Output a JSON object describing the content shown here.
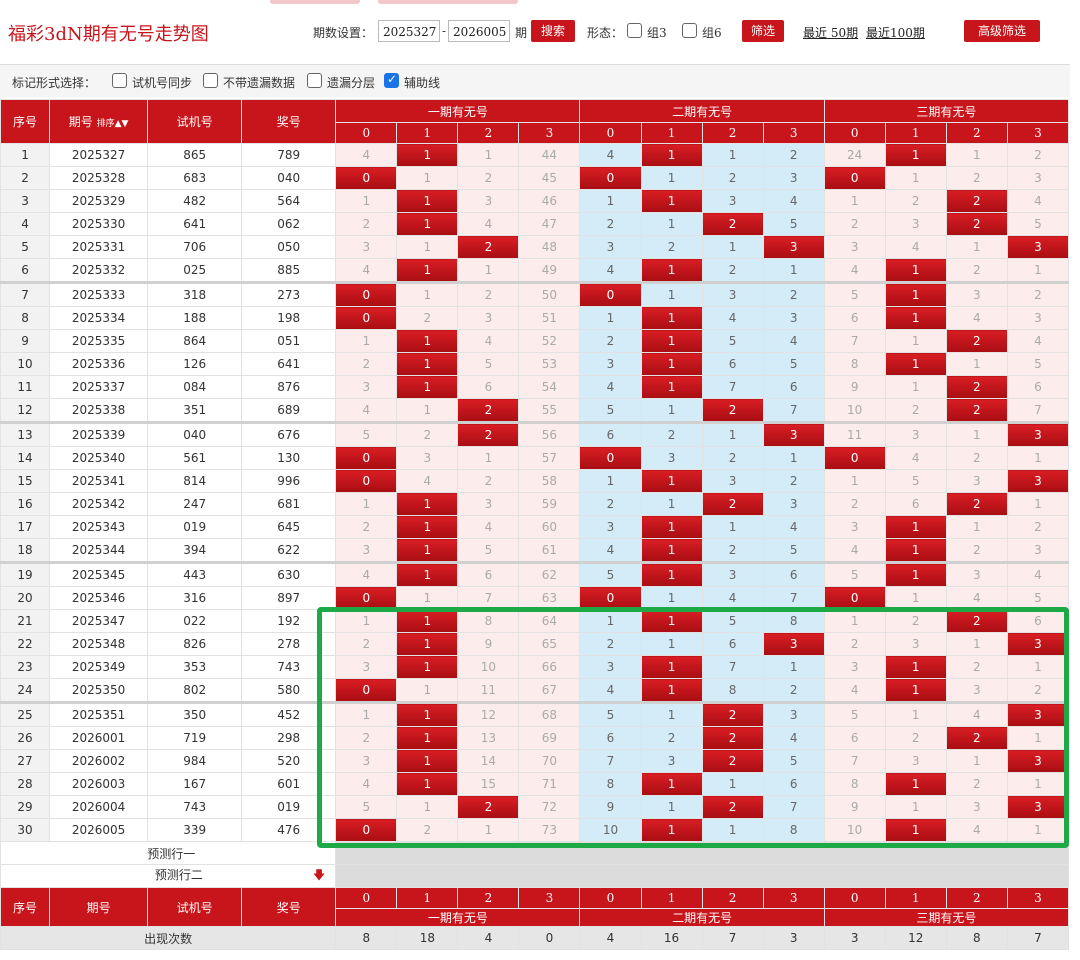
{
  "header": {
    "title": "福彩3dN期有无号走势图",
    "period_label": "期数设置：",
    "from": "2025327",
    "to": "2026005",
    "dash": "-",
    "period_unit": "期",
    "search": "搜索",
    "form_label": "形态：",
    "opt_z3": "组3",
    "opt_z6": "组6",
    "filter": "筛选",
    "recent50": "最近 50期",
    "recent100": "最近100期",
    "advanced": "高级筛选"
  },
  "markbar": {
    "label": "标记形式选择：",
    "opt1": "试机号同步",
    "opt2": "不带遗漏数据",
    "opt3": "遗漏分层",
    "opt4": "辅助线",
    "opt4_checked": true
  },
  "table": {
    "h_seq": "序号",
    "h_period": "期号",
    "h_sort": "排序",
    "h_try": "试机号",
    "h_win": "奖号",
    "groups": [
      "一期有无号",
      "二期有无号",
      "三期有无号"
    ],
    "digits": [
      "0",
      "1",
      "2",
      "3"
    ],
    "rows": [
      {
        "s": "1",
        "p": "2025327",
        "t": "865",
        "w": "789",
        "g1": [
          "4",
          "1",
          "1",
          "44"
        ],
        "h1": 1,
        "g2": [
          "4",
          "1",
          "1",
          "2"
        ],
        "h2": 1,
        "g3": [
          "24",
          "1",
          "1",
          "2"
        ],
        "h3": 1
      },
      {
        "s": "2",
        "p": "2025328",
        "t": "683",
        "w": "040",
        "g1": [
          "0",
          "1",
          "2",
          "45"
        ],
        "h1": 0,
        "g2": [
          "0",
          "1",
          "2",
          "3"
        ],
        "h2": 0,
        "g3": [
          "0",
          "1",
          "2",
          "3"
        ],
        "h3": 0
      },
      {
        "s": "3",
        "p": "2025329",
        "t": "482",
        "w": "564",
        "g1": [
          "1",
          "1",
          "3",
          "46"
        ],
        "h1": 1,
        "g2": [
          "1",
          "1",
          "3",
          "4"
        ],
        "h2": 1,
        "g3": [
          "1",
          "2",
          "2",
          "4"
        ],
        "h3": 2
      },
      {
        "s": "4",
        "p": "2025330",
        "t": "641",
        "w": "062",
        "g1": [
          "2",
          "1",
          "4",
          "47"
        ],
        "h1": 1,
        "g2": [
          "2",
          "1",
          "2",
          "5"
        ],
        "h2": 2,
        "g3": [
          "2",
          "3",
          "2",
          "5"
        ],
        "h3": 2
      },
      {
        "s": "5",
        "p": "2025331",
        "t": "706",
        "w": "050",
        "g1": [
          "3",
          "1",
          "2",
          "48"
        ],
        "h1": 2,
        "g2": [
          "3",
          "2",
          "1",
          "3"
        ],
        "h2": 3,
        "g3": [
          "3",
          "4",
          "1",
          "3"
        ],
        "h3": 3
      },
      {
        "s": "6",
        "p": "2025332",
        "t": "025",
        "w": "885",
        "g1": [
          "4",
          "1",
          "1",
          "49"
        ],
        "h1": 1,
        "g2": [
          "4",
          "1",
          "2",
          "1"
        ],
        "h2": 1,
        "g3": [
          "4",
          "1",
          "2",
          "1"
        ],
        "h3": 1
      },
      {
        "s": "7",
        "p": "2025333",
        "t": "318",
        "w": "273",
        "g1": [
          "0",
          "1",
          "2",
          "50"
        ],
        "h1": 0,
        "g2": [
          "0",
          "1",
          "3",
          "2"
        ],
        "h2": 0,
        "g3": [
          "5",
          "1",
          "3",
          "2"
        ],
        "h3": 1
      },
      {
        "s": "8",
        "p": "2025334",
        "t": "188",
        "w": "198",
        "g1": [
          "0",
          "2",
          "3",
          "51"
        ],
        "h1": 0,
        "g2": [
          "1",
          "1",
          "4",
          "3"
        ],
        "h2": 1,
        "g3": [
          "6",
          "1",
          "4",
          "3"
        ],
        "h3": 1
      },
      {
        "s": "9",
        "p": "2025335",
        "t": "864",
        "w": "051",
        "g1": [
          "1",
          "1",
          "4",
          "52"
        ],
        "h1": 1,
        "g2": [
          "2",
          "1",
          "5",
          "4"
        ],
        "h2": 1,
        "g3": [
          "7",
          "1",
          "2",
          "4"
        ],
        "h3": 2
      },
      {
        "s": "10",
        "p": "2025336",
        "t": "126",
        "w": "641",
        "g1": [
          "2",
          "1",
          "5",
          "53"
        ],
        "h1": 1,
        "g2": [
          "3",
          "1",
          "6",
          "5"
        ],
        "h2": 1,
        "g3": [
          "8",
          "1",
          "1",
          "5"
        ],
        "h3": 1
      },
      {
        "s": "11",
        "p": "2025337",
        "t": "084",
        "w": "876",
        "g1": [
          "3",
          "1",
          "6",
          "54"
        ],
        "h1": 1,
        "g2": [
          "4",
          "1",
          "7",
          "6"
        ],
        "h2": 1,
        "g3": [
          "9",
          "1",
          "2",
          "6"
        ],
        "h3": 2
      },
      {
        "s": "12",
        "p": "2025338",
        "t": "351",
        "w": "689",
        "g1": [
          "4",
          "1",
          "2",
          "55"
        ],
        "h1": 2,
        "g2": [
          "5",
          "1",
          "2",
          "7"
        ],
        "h2": 2,
        "g3": [
          "10",
          "2",
          "2",
          "7"
        ],
        "h3": 2
      },
      {
        "s": "13",
        "p": "2025339",
        "t": "040",
        "w": "676",
        "g1": [
          "5",
          "2",
          "2",
          "56"
        ],
        "h1": 2,
        "g2": [
          "6",
          "2",
          "1",
          "3"
        ],
        "h2": 3,
        "g3": [
          "11",
          "3",
          "1",
          "3"
        ],
        "h3": 3
      },
      {
        "s": "14",
        "p": "2025340",
        "t": "561",
        "w": "130",
        "g1": [
          "0",
          "3",
          "1",
          "57"
        ],
        "h1": 0,
        "g2": [
          "0",
          "3",
          "2",
          "1"
        ],
        "h2": 0,
        "g3": [
          "0",
          "4",
          "2",
          "1"
        ],
        "h3": 0
      },
      {
        "s": "15",
        "p": "2025341",
        "t": "814",
        "w": "996",
        "g1": [
          "0",
          "4",
          "2",
          "58"
        ],
        "h1": 0,
        "g2": [
          "1",
          "1",
          "3",
          "2"
        ],
        "h2": 1,
        "g3": [
          "1",
          "5",
          "3",
          "3"
        ],
        "h3": 3
      },
      {
        "s": "16",
        "p": "2025342",
        "t": "247",
        "w": "681",
        "g1": [
          "1",
          "1",
          "3",
          "59"
        ],
        "h1": 1,
        "g2": [
          "2",
          "1",
          "2",
          "3"
        ],
        "h2": 2,
        "g3": [
          "2",
          "6",
          "2",
          "1"
        ],
        "h3": 2
      },
      {
        "s": "17",
        "p": "2025343",
        "t": "019",
        "w": "645",
        "g1": [
          "2",
          "1",
          "4",
          "60"
        ],
        "h1": 1,
        "g2": [
          "3",
          "1",
          "1",
          "4"
        ],
        "h2": 1,
        "g3": [
          "3",
          "1",
          "1",
          "2"
        ],
        "h3": 1
      },
      {
        "s": "18",
        "p": "2025344",
        "t": "394",
        "w": "622",
        "g1": [
          "3",
          "1",
          "5",
          "61"
        ],
        "h1": 1,
        "g2": [
          "4",
          "1",
          "2",
          "5"
        ],
        "h2": 1,
        "g3": [
          "4",
          "1",
          "2",
          "3"
        ],
        "h3": 1
      },
      {
        "s": "19",
        "p": "2025345",
        "t": "443",
        "w": "630",
        "g1": [
          "4",
          "1",
          "6",
          "62"
        ],
        "h1": 1,
        "g2": [
          "5",
          "1",
          "3",
          "6"
        ],
        "h2": 1,
        "g3": [
          "5",
          "1",
          "3",
          "4"
        ],
        "h3": 1
      },
      {
        "s": "20",
        "p": "2025346",
        "t": "316",
        "w": "897",
        "g1": [
          "0",
          "1",
          "7",
          "63"
        ],
        "h1": 0,
        "g2": [
          "0",
          "1",
          "4",
          "7"
        ],
        "h2": 0,
        "g3": [
          "0",
          "1",
          "4",
          "5"
        ],
        "h3": 0
      },
      {
        "s": "21",
        "p": "2025347",
        "t": "022",
        "w": "192",
        "g1": [
          "1",
          "1",
          "8",
          "64"
        ],
        "h1": 1,
        "g2": [
          "1",
          "1",
          "5",
          "8"
        ],
        "h2": 1,
        "g3": [
          "1",
          "2",
          "2",
          "6"
        ],
        "h3": 2
      },
      {
        "s": "22",
        "p": "2025348",
        "t": "826",
        "w": "278",
        "g1": [
          "2",
          "1",
          "9",
          "65"
        ],
        "h1": 1,
        "g2": [
          "2",
          "1",
          "6",
          "3"
        ],
        "h2": 3,
        "g3": [
          "2",
          "3",
          "1",
          "3"
        ],
        "h3": 3
      },
      {
        "s": "23",
        "p": "2025349",
        "t": "353",
        "w": "743",
        "g1": [
          "3",
          "1",
          "10",
          "66"
        ],
        "h1": 1,
        "g2": [
          "3",
          "1",
          "7",
          "1"
        ],
        "h2": 1,
        "g3": [
          "3",
          "1",
          "2",
          "1"
        ],
        "h3": 1
      },
      {
        "s": "24",
        "p": "2025350",
        "t": "802",
        "w": "580",
        "g1": [
          "0",
          "1",
          "11",
          "67"
        ],
        "h1": 0,
        "g2": [
          "4",
          "1",
          "8",
          "2"
        ],
        "h2": 1,
        "g3": [
          "4",
          "1",
          "3",
          "2"
        ],
        "h3": 1
      },
      {
        "s": "25",
        "p": "2025351",
        "t": "350",
        "w": "452",
        "g1": [
          "1",
          "1",
          "12",
          "68"
        ],
        "h1": 1,
        "g2": [
          "5",
          "1",
          "2",
          "3"
        ],
        "h2": 2,
        "g3": [
          "5",
          "1",
          "4",
          "3"
        ],
        "h3": 3
      },
      {
        "s": "26",
        "p": "2026001",
        "t": "719",
        "w": "298",
        "g1": [
          "2",
          "1",
          "13",
          "69"
        ],
        "h1": 1,
        "g2": [
          "6",
          "2",
          "2",
          "4"
        ],
        "h2": 2,
        "g3": [
          "6",
          "2",
          "2",
          "1"
        ],
        "h3": 2
      },
      {
        "s": "27",
        "p": "2026002",
        "t": "984",
        "w": "520",
        "g1": [
          "3",
          "1",
          "14",
          "70"
        ],
        "h1": 1,
        "g2": [
          "7",
          "3",
          "2",
          "5"
        ],
        "h2": 2,
        "g3": [
          "7",
          "3",
          "1",
          "3"
        ],
        "h3": 3
      },
      {
        "s": "28",
        "p": "2026003",
        "t": "167",
        "w": "601",
        "g1": [
          "4",
          "1",
          "15",
          "71"
        ],
        "h1": 1,
        "g2": [
          "8",
          "1",
          "1",
          "6"
        ],
        "h2": 1,
        "g3": [
          "8",
          "1",
          "2",
          "1"
        ],
        "h3": 1
      },
      {
        "s": "29",
        "p": "2026004",
        "t": "743",
        "w": "019",
        "g1": [
          "5",
          "1",
          "2",
          "72"
        ],
        "h1": 2,
        "g2": [
          "9",
          "1",
          "2",
          "7"
        ],
        "h2": 2,
        "g3": [
          "9",
          "1",
          "3",
          "3"
        ],
        "h3": 3
      },
      {
        "s": "30",
        "p": "2026005",
        "t": "339",
        "w": "476",
        "g1": [
          "0",
          "2",
          "1",
          "73"
        ],
        "h1": 0,
        "g2": [
          "10",
          "1",
          "1",
          "8"
        ],
        "h2": 1,
        "g3": [
          "10",
          "1",
          "4",
          "1"
        ],
        "h3": 1
      }
    ],
    "pred1": "预测行一",
    "pred2": "预测行二",
    "foot_seq": "序号",
    "foot_period": "期号",
    "foot_try": "试机号",
    "foot_win": "奖号",
    "stat_label": "出现次数",
    "stat_values": [
      "8",
      "18",
      "4",
      "0",
      "4",
      "16",
      "7",
      "3",
      "3",
      "12",
      "8",
      "7"
    ]
  },
  "colors": {
    "accent": "#c8141b",
    "highlight": "#1da946",
    "blue": "#d4ecf8",
    "pink": "#fdecec"
  }
}
